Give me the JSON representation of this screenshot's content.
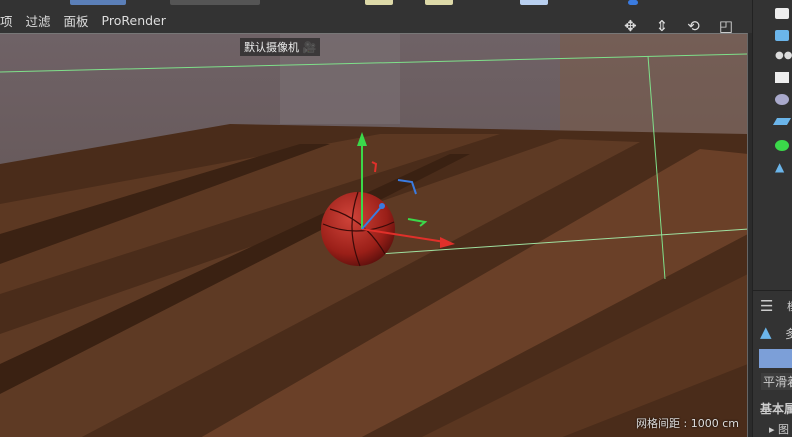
{
  "menu": {
    "items": [
      "项",
      "过滤",
      "面板",
      "ProRender"
    ]
  },
  "viewport": {
    "camera_label": "默认摄像机",
    "grid_spacing": "网格间距 : 1000 cm"
  },
  "nav_icons": [
    "move-view-icon",
    "zoom-view-icon",
    "rotate-view-icon",
    "maximize-view-icon"
  ],
  "attributes": {
    "header": "模",
    "object_label": "多",
    "row_label": "平滑着",
    "section": "基本属",
    "sub_item": "图"
  },
  "colors": {
    "accent": "#7c9fd8",
    "x_axis": "#e0302a",
    "y_axis": "#3bd84a",
    "z_axis": "#3a7be0"
  }
}
